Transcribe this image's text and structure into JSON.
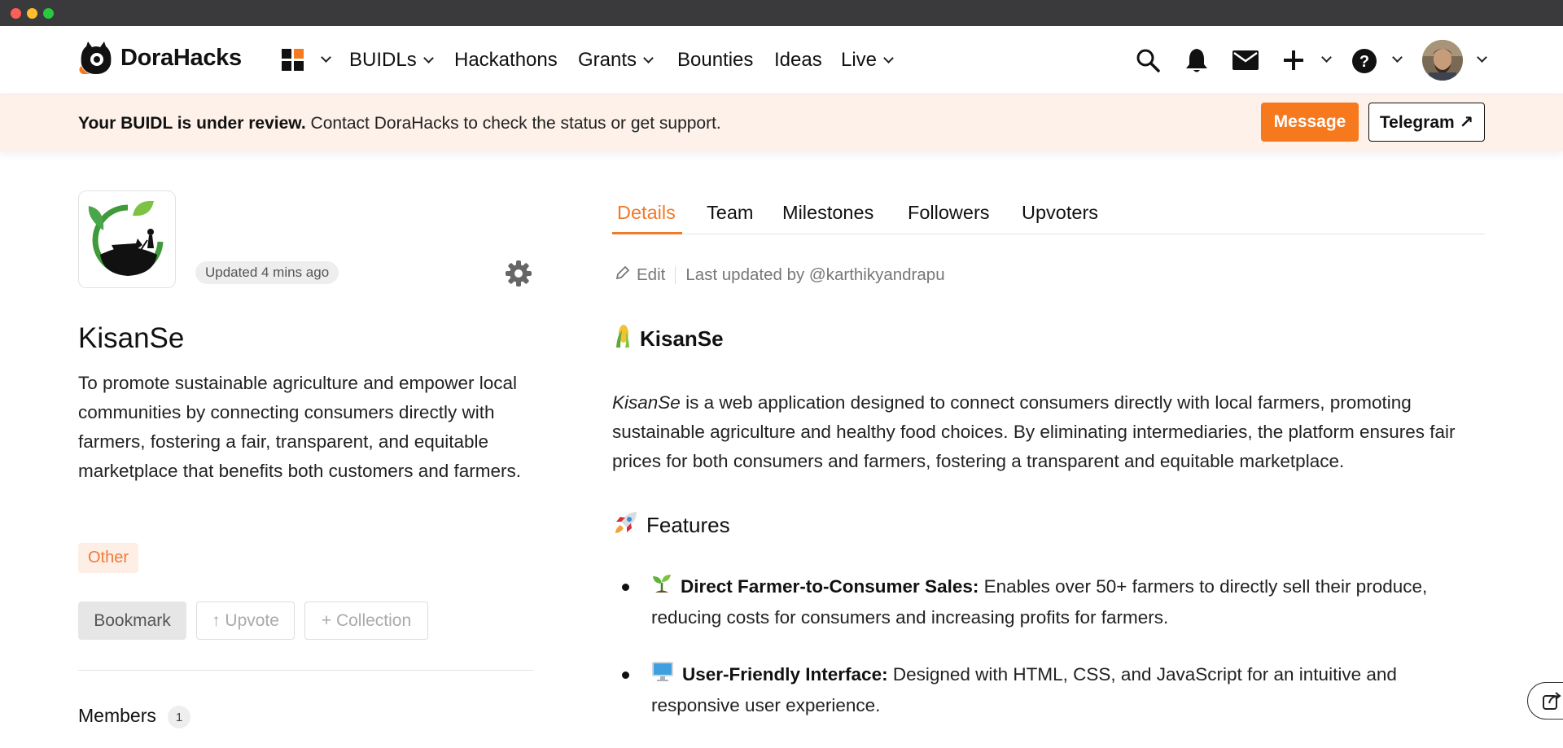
{
  "brand": {
    "name": "DoraHacks",
    "accent": "#f7791e"
  },
  "nav": {
    "items": [
      {
        "label": "BUIDLs",
        "has_dropdown": true
      },
      {
        "label": "Hackathons",
        "has_dropdown": false
      },
      {
        "label": "Grants",
        "has_dropdown": true
      },
      {
        "label": "Bounties",
        "has_dropdown": false
      },
      {
        "label": "Ideas",
        "has_dropdown": false
      },
      {
        "label": "Live",
        "has_dropdown": true
      }
    ],
    "icons": [
      "apps-grid-icon",
      "search-icon",
      "bell-icon",
      "mail-icon",
      "plus-icon",
      "help-icon",
      "avatar"
    ]
  },
  "banner": {
    "strong": "Your BUIDL is under review.",
    "text": " Contact DoraHacks to check the status or get support.",
    "message_label": "Message",
    "telegram_label": "Telegram ↗"
  },
  "project": {
    "updated": "Updated 4 mins ago",
    "title": "KisanSe",
    "description": "To promote sustainable agriculture and empower local communities by connecting consumers directly with farmers, fostering a fair, transparent, and equitable marketplace that benefits both customers and farmers.",
    "tag": "Other",
    "bookmark_label": "Bookmark",
    "upvote_label": "↑ Upvote",
    "collection_label": "+ Collection",
    "members_label": "Members",
    "members_count": "1"
  },
  "tabs": [
    {
      "label": "Details",
      "active": true
    },
    {
      "label": "Team",
      "active": false
    },
    {
      "label": "Milestones",
      "active": false
    },
    {
      "label": "Followers",
      "active": false
    },
    {
      "label": "Upvoters",
      "active": false
    }
  ],
  "edit": {
    "edit_label": "Edit",
    "last_updated": "Last updated by @karthikyandrapu"
  },
  "readme": {
    "heading": "KisanSe",
    "intro_em": "KisanSe",
    "intro_rest": " is a web application designed to connect consumers directly with local farmers, promoting sustainable agriculture and healthy food choices. By eliminating intermediaries, the platform ensures fair prices for both consumers and farmers, fostering a transparent and equitable marketplace.",
    "features_heading": "Features",
    "features": [
      {
        "emoji": "🌱",
        "title": "Direct Farmer-to-Consumer Sales:",
        "text": " Enables over 50+ farmers to directly sell their produce, reducing costs for consumers and increasing profits for farmers."
      },
      {
        "emoji": "🖥",
        "title": "User-Friendly Interface:",
        "text": " Designed with HTML, CSS, and JavaScript for an intuitive and responsive user experience."
      }
    ]
  }
}
